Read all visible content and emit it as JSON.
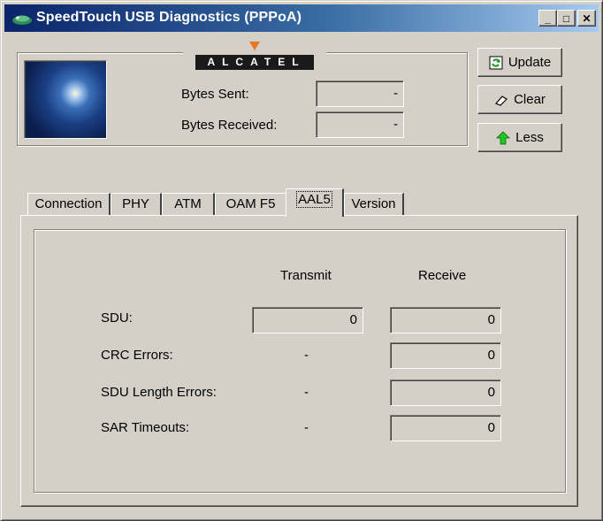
{
  "window": {
    "title": "SpeedTouch USB Diagnostics (PPPoA)",
    "controls": {
      "minimize": "_",
      "maximize": "□",
      "close": "✕"
    }
  },
  "header": {
    "logo_text": "ALCATEL",
    "logo_accent_color": "#e87722",
    "bytes_sent_label": "Bytes Sent:",
    "bytes_sent_value": "-",
    "bytes_received_label": "Bytes Received:",
    "bytes_received_value": "-"
  },
  "buttons": {
    "update": "Update",
    "clear": "Clear",
    "less": "Less"
  },
  "tabs": [
    {
      "label": "Connection",
      "selected": false
    },
    {
      "label": "PHY",
      "selected": false
    },
    {
      "label": "ATM",
      "selected": false
    },
    {
      "label": "OAM F5",
      "selected": false
    },
    {
      "label": "AAL5",
      "selected": true
    },
    {
      "label": "Version",
      "selected": false
    }
  ],
  "aal5": {
    "transmit_header": "Transmit",
    "receive_header": "Receive",
    "rows": [
      {
        "label": "SDU:",
        "transmit": "0",
        "receive": "0"
      },
      {
        "label": "CRC Errors:",
        "transmit": "-",
        "receive": "0"
      },
      {
        "label": "SDU Length Errors:",
        "transmit": "-",
        "receive": "0"
      },
      {
        "label": "SAR Timeouts:",
        "transmit": "-",
        "receive": "0"
      }
    ]
  }
}
